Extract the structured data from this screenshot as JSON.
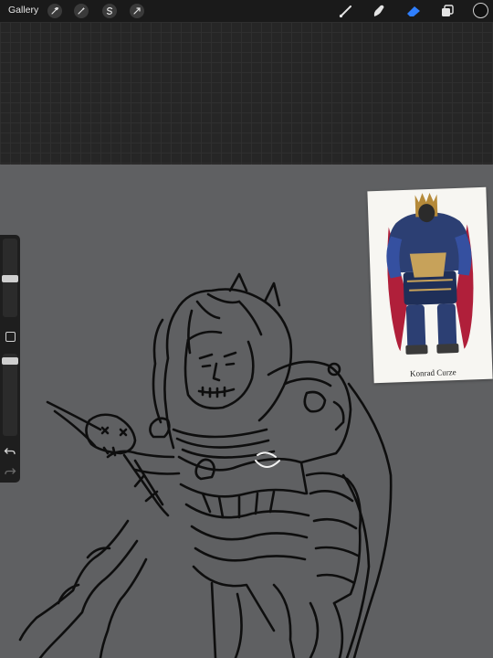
{
  "toolbar": {
    "gallery_label": "Gallery",
    "left_tools": [
      "wrench-icon",
      "magic-wand-icon",
      "selection-icon",
      "transform-icon"
    ],
    "right_tools": [
      "brush-icon",
      "smudge-icon",
      "eraser-icon",
      "layers-icon"
    ],
    "active_tool": "eraser-icon",
    "accent_color": "#2f7fff",
    "current_color": "#111111"
  },
  "sidebar": {
    "size_slider_level": 0.5,
    "opacity_slider_level": 0.1,
    "undo_icon": "undo-icon",
    "redo_icon": "redo-icon"
  },
  "reference": {
    "caption": "Konrad Curze"
  },
  "canvas": {
    "background_color": "#5f6062",
    "grid_color": "#262626"
  }
}
